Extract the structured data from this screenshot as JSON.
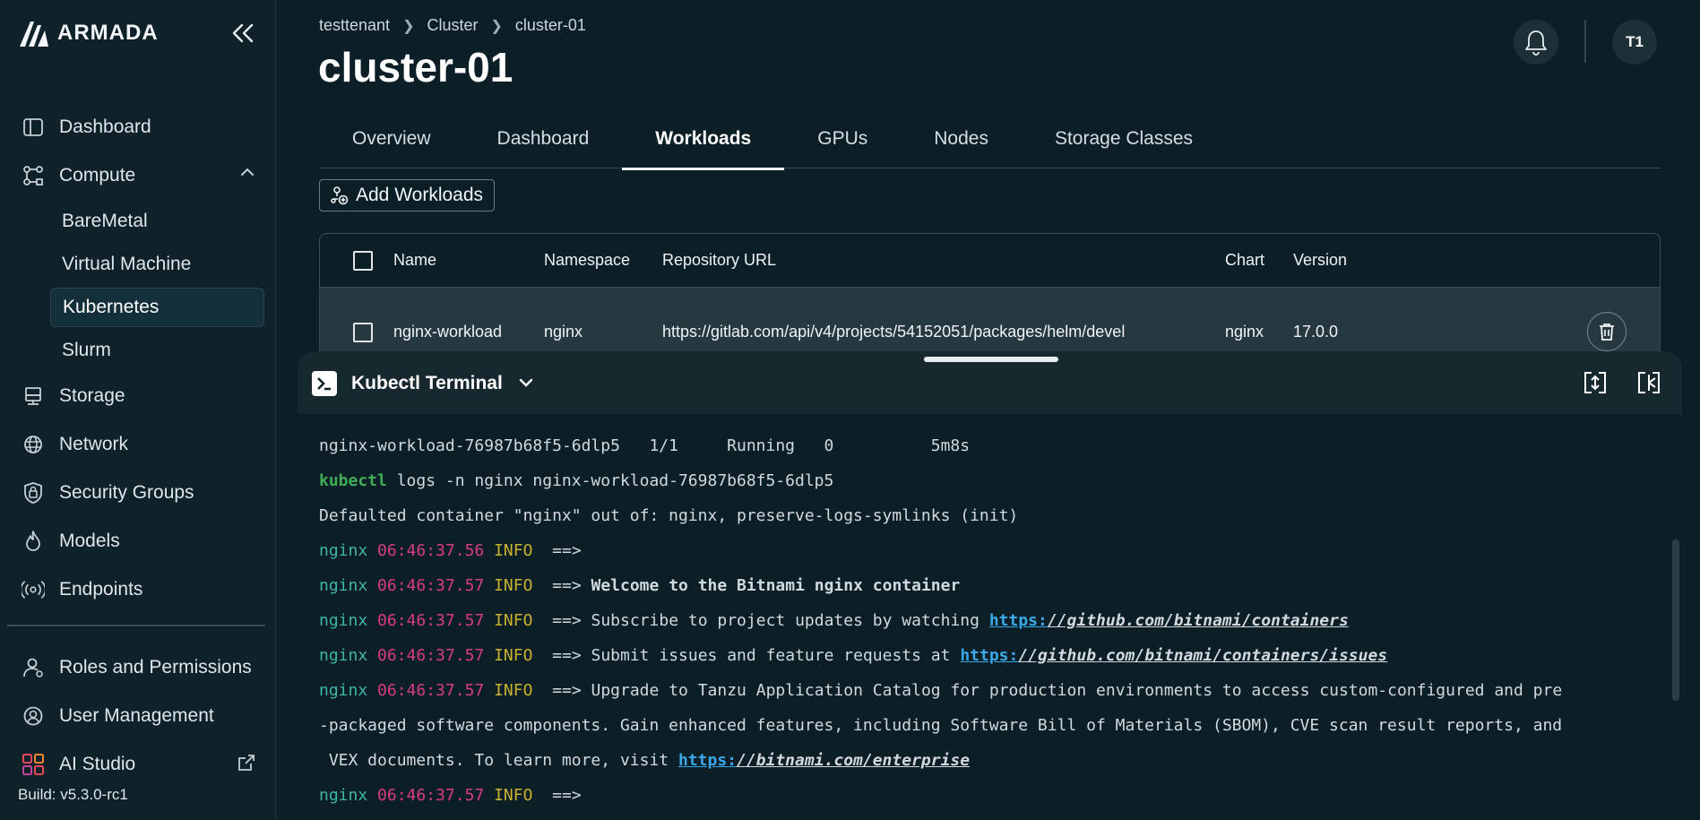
{
  "app": {
    "logo_text": "ARMADA",
    "build": "Build: v5.3.0-rc1"
  },
  "sidebar": {
    "items": [
      {
        "label": "Dashboard",
        "icon": "layout-icon"
      },
      {
        "label": "Compute",
        "icon": "compute-icon",
        "expanded": true
      },
      {
        "label": "Storage",
        "icon": "storage-icon"
      },
      {
        "label": "Network",
        "icon": "globe-icon"
      },
      {
        "label": "Security Groups",
        "icon": "lock-shield-icon"
      },
      {
        "label": "Models",
        "icon": "flame-icon"
      },
      {
        "label": "Endpoints",
        "icon": "broadcast-icon"
      }
    ],
    "compute_children": [
      {
        "label": "BareMetal"
      },
      {
        "label": "Virtual Machine"
      },
      {
        "label": "Kubernetes",
        "active": true
      },
      {
        "label": "Slurm"
      }
    ],
    "bottom_items": [
      {
        "label": "Roles and Permissions",
        "icon": "users-icon"
      },
      {
        "label": "User Management",
        "icon": "user-gear-icon"
      },
      {
        "label": "AI Studio",
        "icon": "grid-icon"
      }
    ]
  },
  "header": {
    "breadcrumb": [
      "testtenant",
      "Cluster",
      "cluster-01"
    ],
    "title": "cluster-01",
    "avatar": "T1"
  },
  "tabs": [
    {
      "label": "Overview"
    },
    {
      "label": "Dashboard"
    },
    {
      "label": "Workloads",
      "active": true
    },
    {
      "label": "GPUs"
    },
    {
      "label": "Nodes"
    },
    {
      "label": "Storage Classes"
    }
  ],
  "actions": {
    "add_workloads": "Add Workloads"
  },
  "table": {
    "columns": [
      "Name",
      "Namespace",
      "Repository URL",
      "Chart",
      "Version"
    ],
    "rows": [
      {
        "name": "nginx-workload",
        "namespace": "nginx",
        "repository_url": "https://gitlab.com/api/v4/projects/54152051/packages/helm/devel",
        "chart": "nginx",
        "version": "17.0.0"
      }
    ]
  },
  "terminal": {
    "title": "Kubectl Terminal",
    "lines": {
      "l1": "nginx-workload-76987b68f5-6dlp5   1/1     Running   0          5m8s",
      "l2_cmd": "kubectl",
      "l2_rest": " logs -n nginx nginx-workload-76987b68f5-6dlp5",
      "l3": "Defaulted container \"nginx\" out of: nginx, preserve-logs-symlinks (init)",
      "prefix": "nginx",
      "level": "INFO",
      "arrow": "==>",
      "t1": "06:46:37.56",
      "t2": "06:46:37.57",
      "welcome": "Welcome to the Bitnami nginx container",
      "subscribe": "Subscribe to project updates by watching ",
      "subscribe_link": "https:",
      "subscribe_url": "//github.com/bitnami/containers",
      "issues": "Submit issues and feature requests at ",
      "issues_link": "https:",
      "issues_url": "//github.com/bitnami/containers/issues",
      "upgrade1": "Upgrade to Tanzu Application Catalog for production environments to access custom-configured and pre",
      "upgrade2": "-packaged software components. Gain enhanced features, including Software Bill of Materials (SBOM), CVE scan result reports, and",
      "upgrade3": " VEX documents. To learn more, visit ",
      "upgrade_link": "https:",
      "upgrade_url": "//bitnami.com/enterprise"
    }
  }
}
